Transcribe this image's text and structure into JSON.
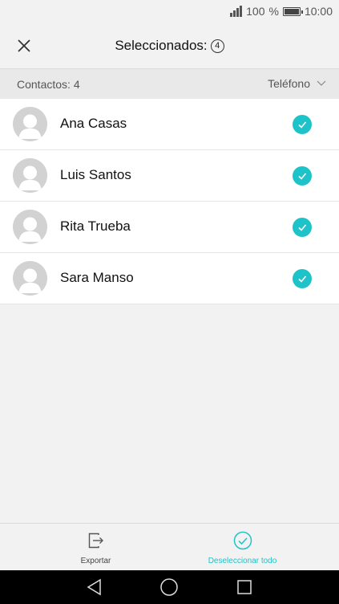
{
  "status_bar": {
    "battery_percent": "100",
    "percent_sign": "%",
    "time": "10:00"
  },
  "header": {
    "title": "Seleccionados:",
    "selected_count": "4",
    "close_icon": "close-icon"
  },
  "subheader": {
    "contacts_label": "Contactos: 4",
    "source": "Teléfono"
  },
  "contacts": [
    {
      "name": "Ana Casas",
      "selected": true
    },
    {
      "name": "Luis Santos",
      "selected": true
    },
    {
      "name": "Rita Trueba",
      "selected": true
    },
    {
      "name": "Sara Manso",
      "selected": true
    }
  ],
  "bottom_bar": {
    "export_label": "Exportar",
    "deselect_label": "Deseleccionar todo"
  },
  "colors": {
    "accent": "#1ec3c9",
    "background": "#f2f2f2",
    "list_background": "#ffffff"
  }
}
